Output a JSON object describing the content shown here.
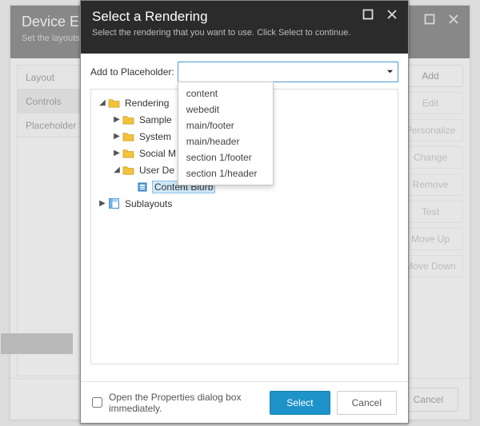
{
  "back": {
    "title": "Device Edi",
    "subtitle": "Set the layouts,",
    "tabs": {
      "layout": "Layout",
      "controls": "Controls",
      "ph": "Placeholder S"
    },
    "buttons": {
      "add": "Add",
      "edit": "Edit",
      "personalize": "Personalize",
      "change": "Change",
      "remove": "Remove",
      "test": "Test",
      "moveup": "Move Up",
      "movedown": "Move Down"
    },
    "cancel": "Cancel"
  },
  "front": {
    "title": "Select a Rendering",
    "subtitle": "Select the rendering that you want to use. Click Select to continue.",
    "ph_label": "Add to Placeholder:",
    "dropdown": [
      "content",
      "webedit",
      "main/footer",
      "main/header",
      "section 1/footer",
      "section 1/header"
    ],
    "tree": {
      "renderings": "Rendering",
      "sample": "Sample",
      "system": "System",
      "social": "Social M",
      "userdef": "User De",
      "content_blurb": "Content Blurb",
      "sublayouts": "Sublayouts"
    },
    "open_props": "Open the Properties dialog box immediately.",
    "select": "Select",
    "cancel": "Cancel"
  }
}
